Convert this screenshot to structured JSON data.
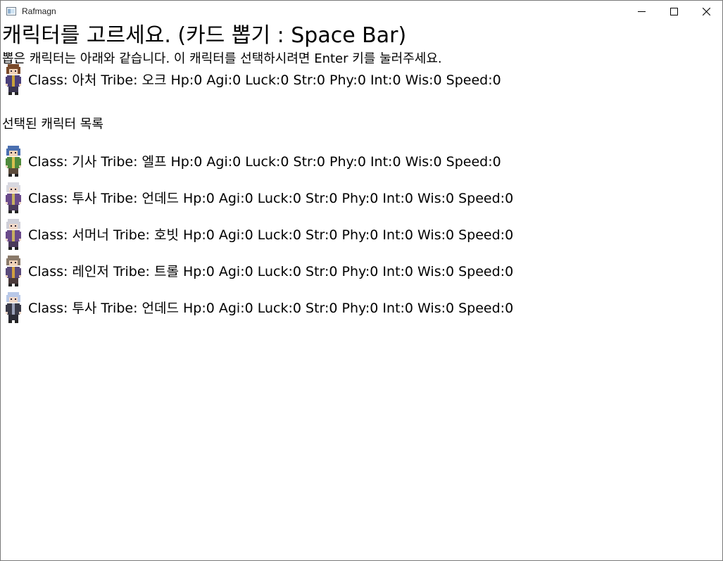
{
  "window": {
    "title": "Rafmagn"
  },
  "screen": {
    "heading": "캐릭터를 고르세요. (카드 뽑기 : Space Bar)",
    "instruction": "뽑은 캐릭터는 아래와 같습니다. 이 캐릭터를 선택하시려면 Enter 키를 눌러주세요.",
    "drawn_character": {
      "text": "Class: 아처 Tribe: 오크 Hp:0 Agi:0 Luck:0 Str:0 Phy:0 Int:0 Wis:0 Speed:0",
      "sprite": {
        "hair": "#7a4a2a",
        "skin": "#f0d3b8",
        "body": "#4a3f7a",
        "trim": "#c8a23a",
        "legs": "#3a3550"
      }
    },
    "selected_title": "선택된 캐릭터 목록",
    "selected_characters": [
      {
        "text": "Class: 기사 Tribe: 엘프 Hp:0 Agi:0 Luck:0 Str:0 Phy:0 Int:0 Wis:0 Speed:0",
        "sprite": {
          "hair": "#4a6fb0",
          "skin": "#f0d3b8",
          "body": "#4f8a3c",
          "trim": "#d8c050",
          "legs": "#5a4a3a"
        }
      },
      {
        "text": "Class: 투사 Tribe: 언데드 Hp:0 Agi:0 Luck:0 Str:0 Phy:0 Int:0 Wis:0 Speed:0",
        "sprite": {
          "hair": "#d8d8e0",
          "skin": "#f0d8c8",
          "body": "#6a4a8a",
          "trim": "#c8b060",
          "legs": "#4a3a5a"
        }
      },
      {
        "text": "Class: 서머너 Tribe: 호빗 Hp:0 Agi:0 Luck:0 Str:0 Phy:0 Int:0 Wis:0 Speed:0",
        "sprite": {
          "hair": "#cfcfd8",
          "skin": "#f0d8c8",
          "body": "#6a4a8a",
          "trim": "#c8b060",
          "legs": "#4a3a5a"
        }
      },
      {
        "text": "Class: 레인저 Tribe: 트롤 Hp:0 Agi:0 Luck:0 Str:0 Phy:0 Int:0 Wis:0 Speed:0",
        "sprite": {
          "hair": "#8a7a6a",
          "skin": "#f0d3b8",
          "body": "#5a4a7a",
          "trim": "#d0a040",
          "legs": "#4a3a3a"
        }
      },
      {
        "text": "Class: 투사 Tribe: 언데드 Hp:0 Agi:0 Luck:0 Str:0 Phy:0 Int:0 Wis:0 Speed:0",
        "sprite": {
          "hair": "#b8c8e8",
          "skin": "#f0d8c8",
          "body": "#3a3a48",
          "trim": "#9aa0b8",
          "legs": "#2a2a35"
        }
      }
    ]
  }
}
